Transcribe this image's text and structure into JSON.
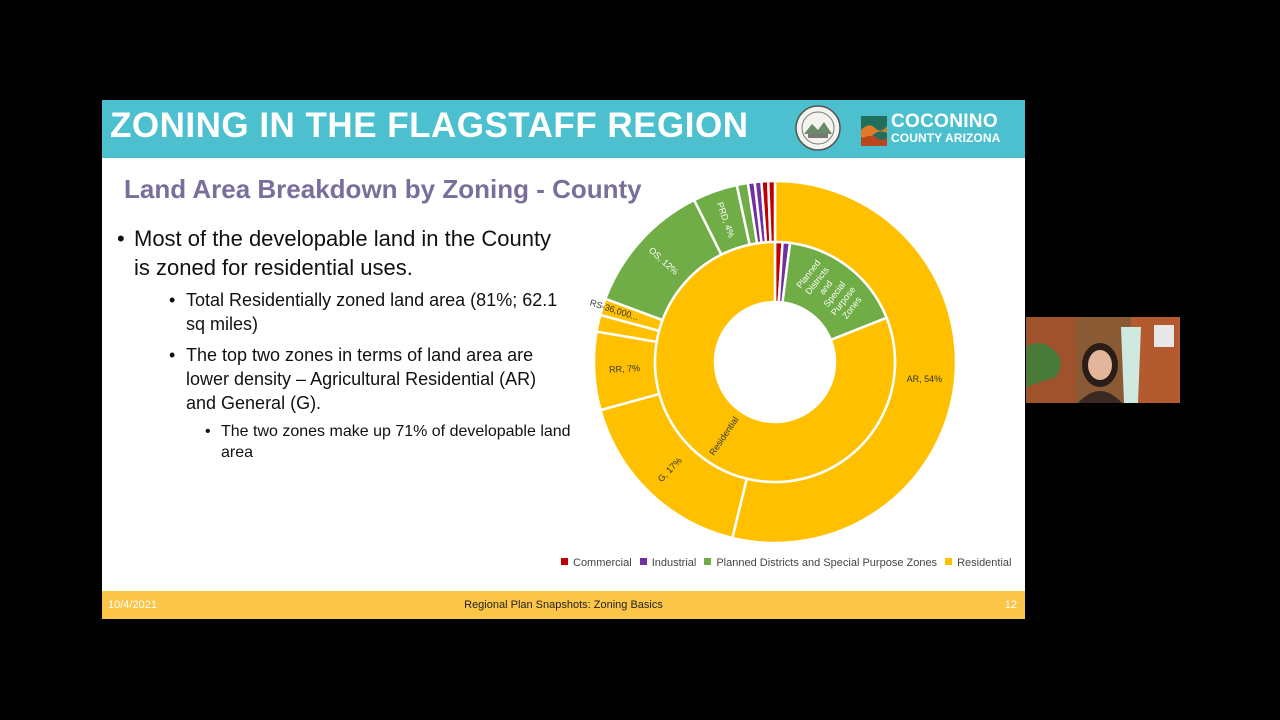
{
  "slide": {
    "title": "ZONING IN THE FLAGSTAFF REGION",
    "subtitle": "Land Area Breakdown by Zoning - County",
    "logo": {
      "main": "COCONINO",
      "sub": "COUNTY ARIZONA"
    },
    "bullets": {
      "b1": "Most of the developable land in the County is zoned for residential uses.",
      "b2a": "Total Residentially zoned land area (81%; 62.1 sq miles)",
      "b2b": "The top two zones in terms of land area are lower density – Agricultural Residential (AR) and General (G).",
      "b3": "The two zones make up 71% of developable land area"
    },
    "footer": {
      "date": "10/4/2021",
      "title": "Regional Plan Snapshots: Zoning Basics",
      "page": "12"
    }
  },
  "colors": {
    "banner": "#4dc0cf",
    "footer": "#fbc547",
    "subtitle": "#7a6f9b"
  },
  "chart_data": {
    "type": "pie",
    "title": "",
    "legend_position": "bottom",
    "categories": [
      {
        "name": "Commercial",
        "color": "#c00000"
      },
      {
        "name": "Industrial",
        "color": "#7030a0"
      },
      {
        "name": "Planned Districts and Special Purpose Zones",
        "color": "#70ad47"
      },
      {
        "name": "Residential",
        "color": "#ffc000"
      }
    ],
    "inner_ring": [
      {
        "label": "",
        "category": "Commercial",
        "value": 1
      },
      {
        "label": "",
        "category": "Industrial",
        "value": 1
      },
      {
        "label": "Planned Districts and Special Purpose Zones",
        "category": "Planned Districts and Special Purpose Zones",
        "value": 17
      },
      {
        "label": "Residential",
        "category": "Residential",
        "value": 81
      }
    ],
    "outer_ring": [
      {
        "label": "AR, 54%",
        "category": "Residential",
        "value": 54
      },
      {
        "label": "G, 17%",
        "category": "Residential",
        "value": 17
      },
      {
        "label": "RR, 7%",
        "category": "Residential",
        "value": 7
      },
      {
        "label": "",
        "category": "Residential",
        "value": 1.5
      },
      {
        "label": "RS-36,000...",
        "category": "Residential",
        "value": 1.5
      },
      {
        "label": "OS, 12%",
        "category": "Planned Districts and Special Purpose Zones",
        "value": 12
      },
      {
        "label": "PRD, 4%",
        "category": "Planned Districts and Special Purpose Zones",
        "value": 4
      },
      {
        "label": "",
        "category": "Planned Districts and Special Purpose Zones",
        "value": 1
      },
      {
        "label": "",
        "category": "Industrial",
        "value": 0.6
      },
      {
        "label": "",
        "category": "Industrial",
        "value": 0.6
      },
      {
        "label": "",
        "category": "Commercial",
        "value": 0.6
      },
      {
        "label": "",
        "category": "Commercial",
        "value": 0.6
      }
    ]
  }
}
